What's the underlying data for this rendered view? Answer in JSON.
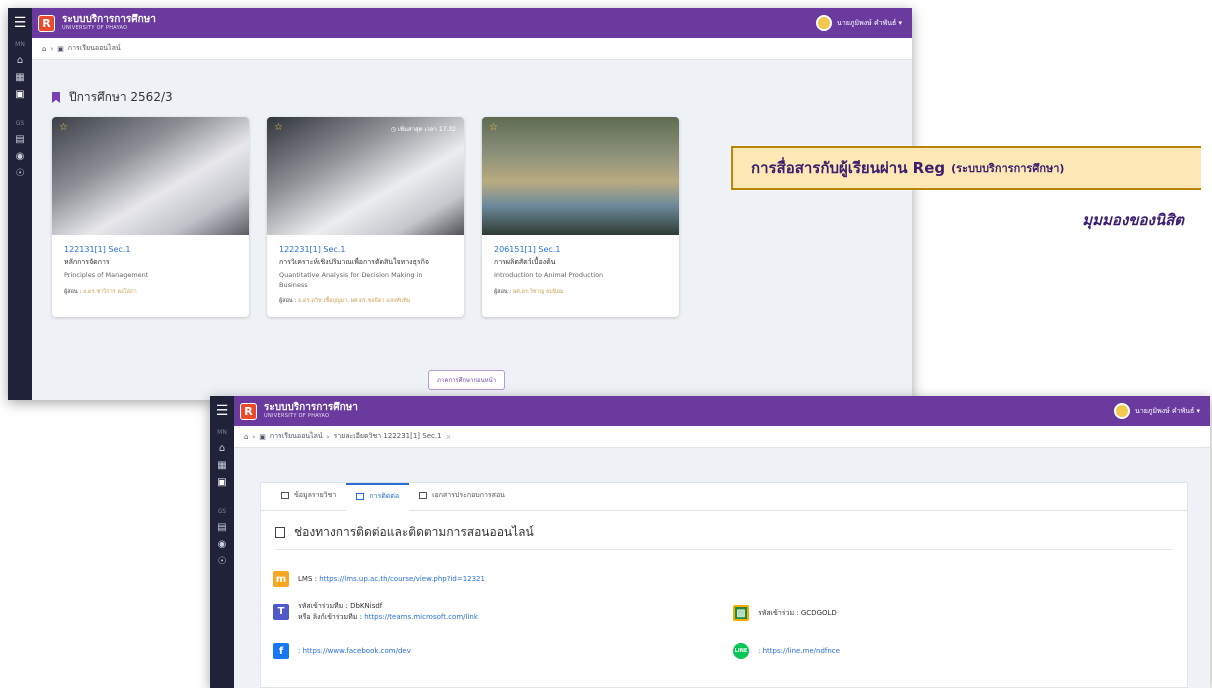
{
  "app": {
    "title": "ระบบบริการการศึกษา",
    "subtitle": "UNIVERSITY OF PHAYAO",
    "user": "นายภูมิพงษ์ คำพันธ์"
  },
  "sidebar": {
    "group1": "MN",
    "group2": "GS"
  },
  "window1": {
    "breadcrumb": [
      "การเรียนออนไลน์"
    ],
    "semester_title": "ปีการศึกษา 2562/3",
    "courses": [
      {
        "code": "122131[1] Sec.1",
        "name_th": "หลักการจัดการ",
        "name_en": "Principles of Management",
        "teacher_label": "ผู้สอน :",
        "teacher": "อ.ดร.ชาวิการ คงโสภา",
        "timer": ""
      },
      {
        "code": "122231[1] Sec.1",
        "name_th": "การวิเคราะห์เชิงปริมาณเพื่อการตัดสินใจทางธุรกิจ",
        "name_en": "Quantitative Analysis for Decision Making in Business",
        "teacher_label": "ผู้สอน :",
        "teacher": "อ.ดร.ดวิช เชื้อบุญมา, ผศ.ดร.ชลธิดา แสงทับทิม",
        "timer": "เพิ่มล่าสุด เวลา 17.32"
      },
      {
        "code": "206151[1] Sec.1",
        "name_th": "การผลิตสัตว์เบื้องต้น",
        "name_en": "Introduction to Animal Production",
        "teacher_label": "ผู้สอน :",
        "teacher": "ผศ.ดร.วิชาญ ยมนิยม",
        "timer": ""
      }
    ],
    "history_button": "ภาคการศึกษาก่อนหน้า"
  },
  "window2": {
    "breadcrumb": [
      "การเรียนออนไลน์",
      "รายละเอียดวิชา 122231[1] Sec.1"
    ],
    "tabs": [
      "ข้อมูลรายวิชา",
      "การติดต่อ",
      "เอกสารประกอบการสอน"
    ],
    "section_title": "ช่องทางการติดต่อและติดตามการสอนออนไลน์",
    "lms_label": "LMS :",
    "lms_url": "https://lms.up.ac.th/course/view.php?id=12321",
    "teams_code_label": "รหัสเข้าร่วมทีม : DbKNisdf",
    "teams_link_label": "หรือ ลิงก์เข้าร่วมทีม :",
    "teams_url": "https://teams.microsoft.com/link",
    "classroom_label": "รหัสเข้าร่วม : GCDGOLD",
    "facebook_url": ": https://www.facebook.com/dev",
    "line_url": ": https://line.me/ndfnce"
  },
  "annotation": {
    "banner_main": "การสื่อสารกับผู้เรียนผ่าน Reg",
    "banner_sub": "(ระบบบริการการศึกษา)",
    "caption": "มุมมองของนิสิต"
  },
  "colors": {
    "header": "#6a3a9f",
    "sidebar": "#20223a",
    "link": "#2b6fd6",
    "accent": "#7b3fb5"
  }
}
